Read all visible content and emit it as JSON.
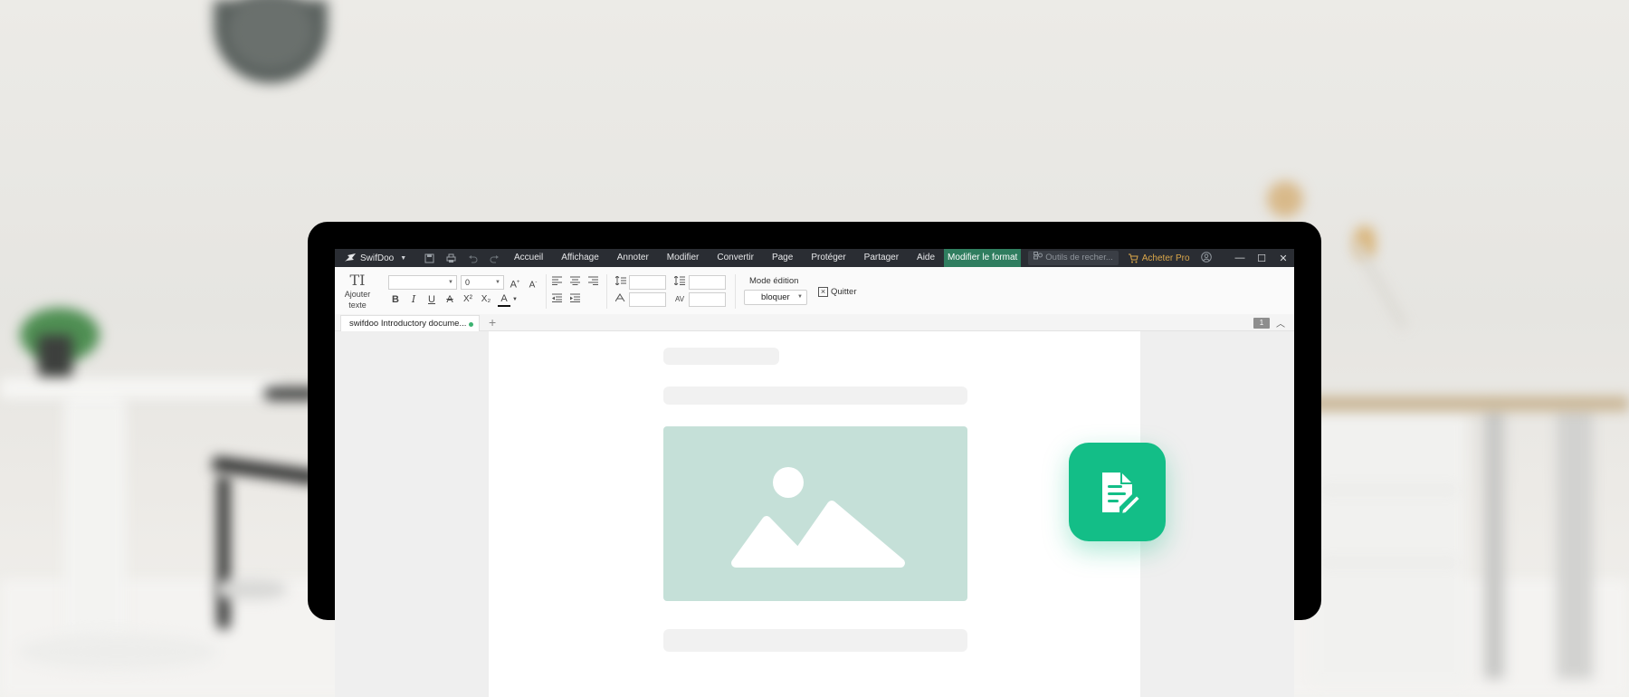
{
  "app": {
    "name": "SwifDoo",
    "brand_color": "#13be87",
    "titlebar_color": "#2a2d33"
  },
  "quick_access": {
    "icons": [
      "save-icon",
      "print-icon",
      "undo-icon",
      "redo-icon"
    ]
  },
  "menu": {
    "items": [
      {
        "label": "Accueil"
      },
      {
        "label": "Affichage"
      },
      {
        "label": "Annoter"
      },
      {
        "label": "Modifier"
      },
      {
        "label": "Convertir"
      },
      {
        "label": "Page"
      },
      {
        "label": "Protéger"
      },
      {
        "label": "Partager"
      },
      {
        "label": "Aide"
      },
      {
        "label": "Modifier le format",
        "active": true
      }
    ],
    "search_tools": "Outils de recher...",
    "buy_pro": "Acheter Pro"
  },
  "window_controls": [
    "minimize-icon",
    "maximize-icon",
    "close-icon"
  ],
  "ribbon": {
    "add_text_icon": "TI",
    "add_text_label_1": "Ajouter",
    "add_text_label_2": "texte",
    "font_name": "",
    "font_size": "0",
    "format_buttons": [
      "B",
      "I",
      "U",
      "A",
      "X²",
      "X₂",
      "A"
    ],
    "mode_label": "Mode édition",
    "mode_value": "bloquer",
    "quit_label": "Quitter"
  },
  "tabs": {
    "document_tab": "swifdoo Introductory docume...",
    "add_tab": "+",
    "page_number": "1"
  }
}
